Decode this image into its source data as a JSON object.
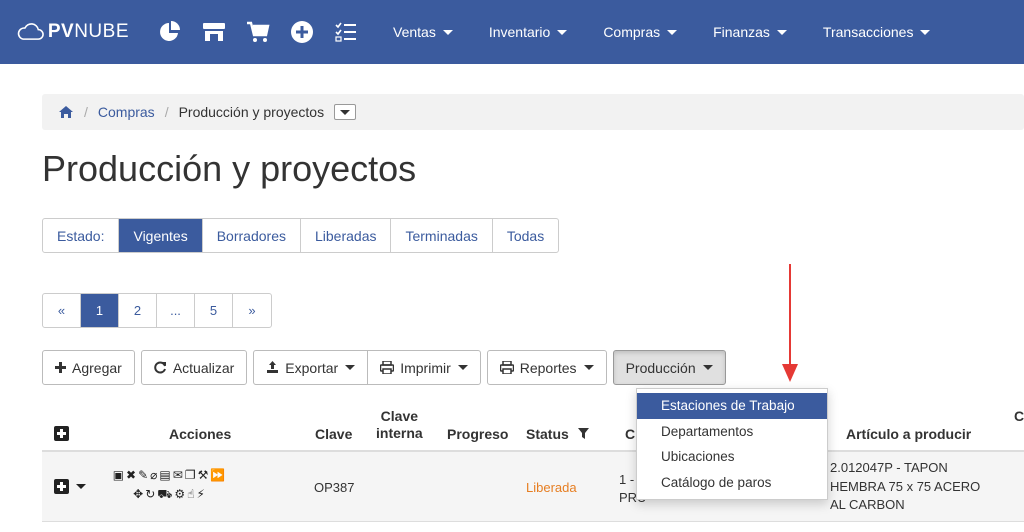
{
  "brand": {
    "name_bold": "PV",
    "name_rest": "NUBE"
  },
  "nav": {
    "icons": [
      "pie-chart-icon",
      "store-icon",
      "cart-icon",
      "plus-circle-icon",
      "checklist-icon"
    ],
    "menu": [
      {
        "label": "Ventas"
      },
      {
        "label": "Inventario"
      },
      {
        "label": "Compras"
      },
      {
        "label": "Finanzas"
      },
      {
        "label": "Transacciones"
      }
    ]
  },
  "breadcrumb": {
    "home_icon": "home-icon",
    "compras": "Compras",
    "current": "Producción y proyectos"
  },
  "page": {
    "title": "Producción y proyectos"
  },
  "status_filter": {
    "label": "Estado:",
    "options": [
      "Vigentes",
      "Borradores",
      "Liberadas",
      "Terminadas",
      "Todas"
    ],
    "active": "Vigentes"
  },
  "pagination": {
    "prev": "«",
    "pages": [
      "1",
      "2",
      "...",
      "5"
    ],
    "next": "»",
    "current": "1"
  },
  "toolbar": {
    "agregar": "Agregar",
    "actualizar": "Actualizar",
    "exportar": "Exportar",
    "imprimir": "Imprimir",
    "reportes": "Reportes",
    "produccion": "Producción"
  },
  "produccion_menu": {
    "items": [
      "Estaciones de Trabajo",
      "Departamentos",
      "Ubicaciones",
      "Catálogo de paros"
    ],
    "highlighted": "Estaciones de Trabajo"
  },
  "table": {
    "headers": {
      "acciones": "Acciones",
      "clave": "Clave",
      "clave_interna_1": "Clave",
      "clave_interna_2": "interna",
      "progreso": "Progreso",
      "status": "Status",
      "cl": "Cl",
      "articulo": "Artículo a producir",
      "c": "C"
    },
    "rows": [
      {
        "clave": "OP387",
        "clave_interna": "",
        "progreso": "",
        "status": "Liberada",
        "cliente_1": "1 -",
        "cliente_2": "PRU",
        "articulo_1": "2.012047P - TAPON",
        "articulo_2": "HEMBRA 75 x 75 ACERO",
        "articulo_3": "AL CARBON"
      }
    ]
  },
  "colors": {
    "navbar": "#3b5b9e",
    "accent": "#3b5b9e",
    "status_liberada": "#e67e22",
    "arrow": "#e53935"
  }
}
